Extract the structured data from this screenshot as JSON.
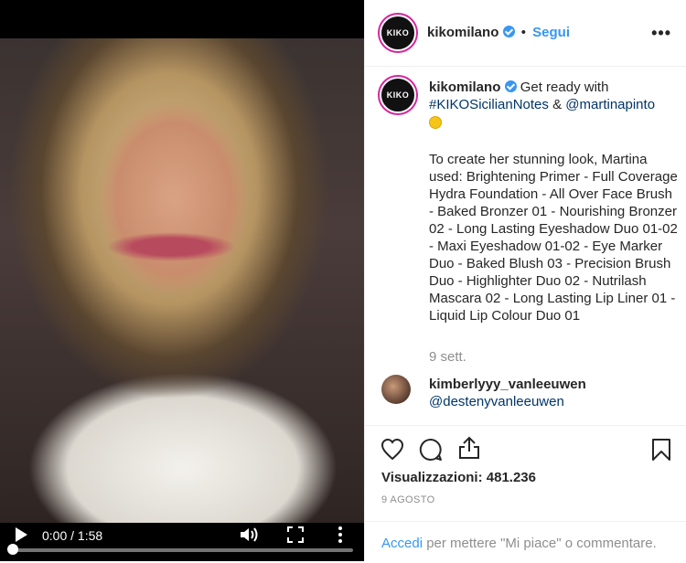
{
  "video": {
    "time": "0:00 / 1:58",
    "progress": 0.0
  },
  "header": {
    "avatar_text": "KIKO",
    "username": "kikomilano",
    "separator": "•",
    "follow_label": "Segui",
    "options": "•••"
  },
  "caption": {
    "avatar_text": "KIKO",
    "username": "kikomilano",
    "intro": "Get ready with",
    "hashtag": "#KIKOSicilianNotes",
    "amp": "&",
    "mention": "@martinapinto",
    "body": "To create her stunning look, Martina used: Brightening Primer - Full Coverage Hydra Foundation - All Over Face Brush - Baked Bronzer 01 - Nourishing Bronzer 02 - Long Lasting Eyeshadow Duo 01-02 - Maxi Eyeshadow 01-02 - Eye Marker Duo - Baked Blush 03 - Precision Brush Duo - Highlighter Duo 02 - Nutrilash Mascara 02 - Long Lasting Lip Liner 01 - Liquid Lip Colour Duo 01",
    "age": "9 sett."
  },
  "comment": {
    "username": "kimberlyyy_vanleeuwen",
    "text": "@destenyvanleeuwen"
  },
  "actions": {
    "views_label": "Visualizzazioni:",
    "views_count": "481.236",
    "date": "9 AGOSTO"
  },
  "login": {
    "link": "Accedi",
    "rest": "per mettere \"Mi piace\" o commentare."
  },
  "colors": {
    "accent": "#3897f0",
    "link": "#003569",
    "muted": "#8e8e8e"
  }
}
